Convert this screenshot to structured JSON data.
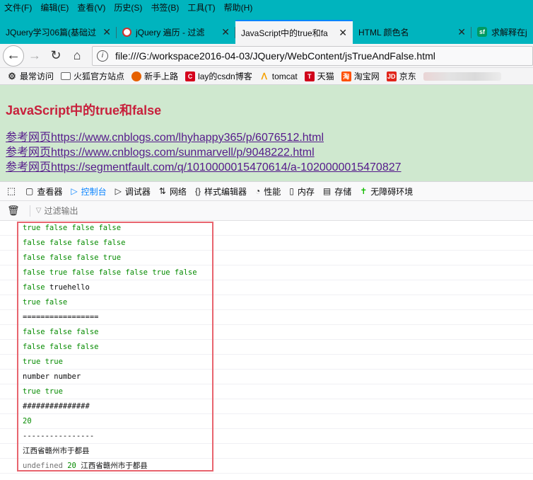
{
  "menu": [
    "文件(F)",
    "编辑(E)",
    "查看(V)",
    "历史(S)",
    "书签(B)",
    "工具(T)",
    "帮助(H)"
  ],
  "tabs": [
    {
      "label": "JQuery学习06篇(基础过"
    },
    {
      "label": "jQuery 遍历 - 过滤"
    },
    {
      "label": "JavaScript中的true和fa"
    },
    {
      "label": "HTML 颜色名"
    },
    {
      "label": "求解释在js"
    }
  ],
  "url": "file:///G:/workspace2016-04-03/JQuery/WebContent/jsTrueAndFalse.html",
  "bookmarks": [
    "最常访问",
    "火狐官方站点",
    "新手上路",
    "lay的csdn博客",
    "tomcat",
    "天猫",
    "淘宝网",
    "京东"
  ],
  "page": {
    "title": "JavaScript中的true和false",
    "links": [
      "参考网页https://www.cnblogs.com/lhyhappy365/p/6076512.html",
      "参考网页https://www.cnblogs.com/sunmarvell/p/9048222.html",
      "参考网页https://segmentfault.com/q/1010000015470614/a-1020000015470827"
    ]
  },
  "devtools": {
    "tabs": [
      "查看器",
      "控制台",
      "调试器",
      "网络",
      "样式编辑器",
      "性能",
      "内存",
      "存储",
      "无障碍环境"
    ],
    "filter_placeholder": "过滤输出"
  },
  "console": {
    "lines": [
      {
        "text": "true false false false",
        "color": "green"
      },
      {
        "text": "false false false false",
        "color": "green"
      },
      {
        "text": "false false false true",
        "color": "green"
      },
      {
        "text": "false true false false false true false",
        "color": "green"
      },
      {
        "text": "false truehello",
        "color": "mixed"
      },
      {
        "text": "true false",
        "color": "green"
      },
      {
        "text": "=================",
        "color": "black"
      },
      {
        "text": "false false false",
        "color": "green"
      },
      {
        "text": "false false false",
        "color": "green"
      },
      {
        "text": "true true",
        "color": "green"
      },
      {
        "text": "number number",
        "color": "black"
      },
      {
        "text": "true true",
        "color": "green"
      },
      {
        "text": "###############",
        "color": "black"
      },
      {
        "text": "20",
        "color": "green"
      },
      {
        "text": "----------------",
        "color": "black"
      },
      {
        "text": "江西省赣州市于都县",
        "color": "black"
      },
      {
        "text": "undefined 20 江西省赣州市于都县",
        "color": "mixed"
      }
    ]
  },
  "colors": {
    "chrome": "#00b4be",
    "page_bg": "#cfe8cf",
    "title": "#c8203c",
    "console_true_false": "#058b00",
    "highlight_box": "#e8646e"
  }
}
